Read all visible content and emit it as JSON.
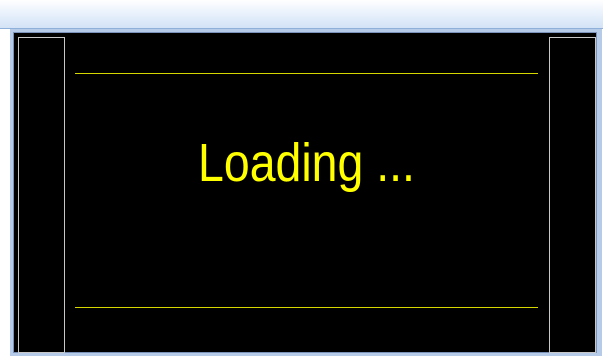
{
  "window": {
    "title": ""
  },
  "display": {
    "message": "Loading ..."
  },
  "colors": {
    "title_bar": "#d3e3f6",
    "frame": "#b6cbe8",
    "screen_background": "#000000",
    "text": "#ffff00",
    "divider_lines": "#d6d600"
  }
}
